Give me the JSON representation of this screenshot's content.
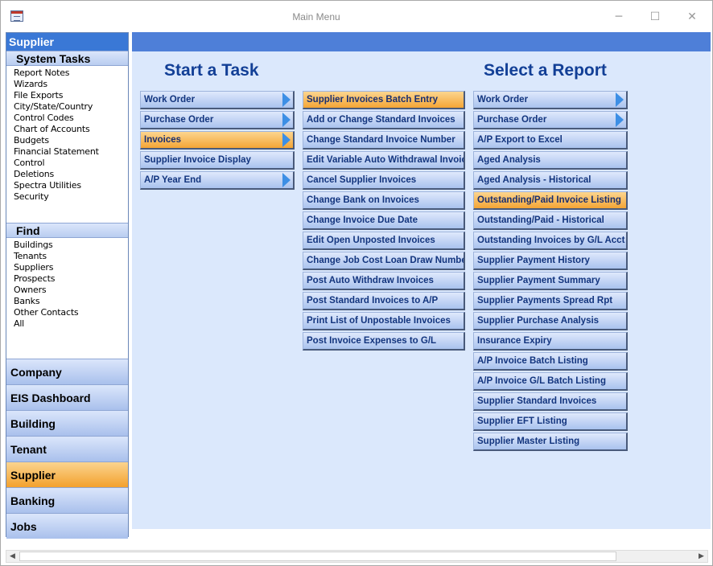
{
  "window": {
    "title": "Main Menu",
    "controls": [
      "─",
      "☐",
      "✕"
    ]
  },
  "sidebar": {
    "header": "Supplier",
    "system_tasks_title": "System Tasks",
    "system_tasks": [
      "Report Notes",
      "Wizards",
      "File Exports",
      "City/State/Country",
      "Control Codes",
      "Chart of Accounts",
      "Budgets",
      "Financial Statement Control",
      "Deletions",
      "Spectra Utilities",
      "Security"
    ],
    "find_title": "Find",
    "find_items": [
      "Buildings",
      "Tenants",
      "Suppliers",
      "Prospects",
      "Owners",
      "Banks",
      "Other Contacts",
      "All"
    ],
    "nav": [
      "Company",
      "EIS Dashboard",
      "Building",
      "Tenant",
      "Supplier",
      "Banking",
      "Jobs"
    ],
    "active_nav": "Supplier"
  },
  "main": {
    "task_heading": "Start a Task",
    "report_heading": "Select a Report",
    "tasks": [
      {
        "label": "Work Order",
        "submenu": true
      },
      {
        "label": "Purchase Order",
        "submenu": true
      },
      {
        "label": "Invoices",
        "submenu": true,
        "active": true
      },
      {
        "label": "Supplier Invoice Display",
        "submenu": false
      },
      {
        "label": "A/P Year End",
        "submenu": true
      }
    ],
    "invoice_tasks": [
      {
        "label": "Supplier Invoices Batch Entry",
        "active": true
      },
      {
        "label": "Add or Change Standard Invoices"
      },
      {
        "label": "Change Standard Invoice Number"
      },
      {
        "label": "Edit Variable Auto Withdrawal Invoice"
      },
      {
        "label": "Cancel Supplier Invoices"
      },
      {
        "label": "Change Bank on Invoices"
      },
      {
        "label": "Change Invoice Due Date"
      },
      {
        "label": "Edit Open Unposted Invoices"
      },
      {
        "label": "Change Job Cost Loan Draw Number"
      },
      {
        "label": "Post Auto Withdraw Invoices"
      },
      {
        "label": "Post Standard Invoices to A/P"
      },
      {
        "label": "Print List of Unpostable Invoices"
      },
      {
        "label": "Post Invoice Expenses to G/L"
      }
    ],
    "reports": [
      {
        "label": "Work Order",
        "submenu": true
      },
      {
        "label": "Purchase Order",
        "submenu": true
      },
      {
        "label": "A/P Export to Excel"
      },
      {
        "label": "Aged Analysis"
      },
      {
        "label": "Aged Analysis - Historical"
      },
      {
        "label": "Outstanding/Paid Invoice Listing",
        "active": true
      },
      {
        "label": "Outstanding/Paid - Historical"
      },
      {
        "label": "Outstanding Invoices by G/L Acct"
      },
      {
        "label": "Supplier Payment History"
      },
      {
        "label": "Supplier Payment Summary"
      },
      {
        "label": "Supplier Payments Spread Rpt"
      },
      {
        "label": "Supplier Purchase Analysis"
      },
      {
        "label": "Insurance Expiry"
      },
      {
        "label": "A/P Invoice Batch Listing"
      },
      {
        "label": "A/P Invoice G/L Batch Listing"
      },
      {
        "label": "Supplier Standard Invoices"
      },
      {
        "label": "Supplier EFT Listing"
      },
      {
        "label": "Supplier Master Listing"
      }
    ]
  },
  "scrollbar": {
    "left_arrow": "◀",
    "right_arrow": "▶"
  }
}
